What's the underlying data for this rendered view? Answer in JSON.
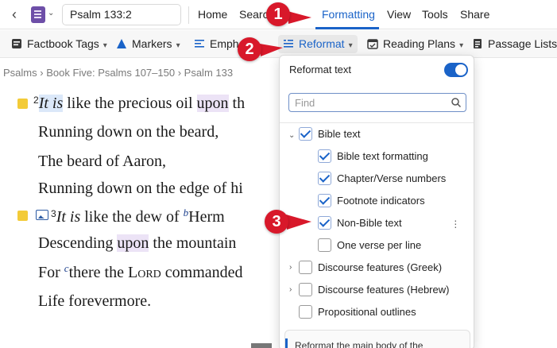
{
  "topbar": {
    "back_icon": "chevron-left-icon",
    "doc_icon": "document-icon",
    "reference": "Psalm 133:2",
    "menu": [
      "Home",
      "Search",
      "Formatting",
      "View",
      "Tools",
      "Share"
    ],
    "active_menu": "Formatting",
    "accent": "#1a63c8"
  },
  "toolbar": {
    "items": [
      "Factbook Tags",
      "Markers",
      "Emph",
      "Reformat",
      "Reading Plans",
      "Passage Lists"
    ]
  },
  "breadcrumb": [
    "Psalms",
    "Book Five: Psalms 107–150",
    "Psalm 133"
  ],
  "bible": {
    "v2_num": "2",
    "v2_l1a": "It is",
    "v2_l1b": " like the precious oil ",
    "v2_l1c": "upon",
    "v2_l1d": " th",
    "v2_l2": "Running down on the beard,",
    "v2_l3": "The beard of Aaron,",
    "v2_l4": "Running down on the edge of hi",
    "v3_num": "3",
    "v3_l1a": "It is",
    "v3_l1b": " like the dew of ",
    "v3_fn": "b",
    "v3_l1c": "Herm",
    "v3_l2a": "Descending ",
    "v3_l2b": "upon",
    "v3_l2c": " the mountain",
    "v3_l3_fn": "c",
    "v3_l3a": "For ",
    "v3_l3b": "there the L",
    "v3_l3c": "ord",
    "v3_l3d": " commanded",
    "v3_l4": "Life forevermore."
  },
  "panel": {
    "title": "Reformat text",
    "toggle_on": true,
    "find_placeholder": "Find",
    "options": {
      "bible_text": "Bible text",
      "bible_text_formatting": "Bible text formatting",
      "chapter_verse_numbers": "Chapter/Verse numbers",
      "footnote_indicators": "Footnote indicators",
      "non_bible_text": "Non-Bible text",
      "one_verse_per_line": "One verse per line",
      "discourse_greek": "Discourse features (Greek)",
      "discourse_hebrew": "Discourse features (Hebrew)",
      "propositional_outlines": "Propositional outlines"
    },
    "info_text": "Reformat the main body of the"
  },
  "badges": [
    "1",
    "2",
    "3"
  ],
  "colors": {
    "badge": "#d8182a",
    "note": "#f3cb38",
    "highlight_purple": "#ece3f6",
    "highlight_blue": "#dbe8f9"
  }
}
